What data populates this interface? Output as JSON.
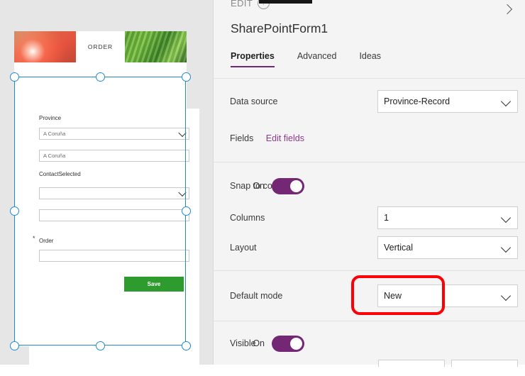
{
  "canvas": {
    "app_header": {
      "title": "ORDER",
      "left_image": "tomato-photo",
      "right_image": "green-leaves-photo"
    },
    "form": {
      "fields": [
        {
          "label": "Province",
          "type": "dropdown",
          "value": "A Coruña",
          "required": false
        },
        {
          "label": "",
          "type": "text",
          "value": "A Coruña",
          "required": false
        },
        {
          "label": "ContactSelected",
          "type": "dropdown",
          "value": "",
          "required": false
        },
        {
          "label": "",
          "type": "text",
          "value": "",
          "required": false
        },
        {
          "label": "Order",
          "type": "text",
          "value": "",
          "required": true
        }
      ],
      "save_label": "Save",
      "save_color": "#2e9b2e"
    },
    "selection_color": "#1f8ad2"
  },
  "panel": {
    "breadcrumb": "EDIT",
    "help_icon": "question-mark-icon",
    "collapse_icon": "chevron-right-icon",
    "title": "SharePointForm1",
    "tabs": [
      {
        "label": "Properties",
        "active": true
      },
      {
        "label": "Advanced",
        "active": false
      },
      {
        "label": "Ideas",
        "active": false
      }
    ],
    "accent_color": "#742774",
    "link_color": "#8a3a8a",
    "highlight_color": "#fb0007",
    "rows": [
      {
        "label": "Data source",
        "control": "dropdown",
        "value": "Province-Record"
      },
      {
        "label": "Fields",
        "control": "link",
        "value": "Edit fields"
      },
      {
        "label": "Snap to columns",
        "control": "toggle",
        "value": "On"
      },
      {
        "label": "Columns",
        "control": "dropdown",
        "value": "1"
      },
      {
        "label": "Layout",
        "control": "dropdown",
        "value": "Vertical"
      },
      {
        "label": "Default mode",
        "control": "dropdown",
        "value": "New"
      },
      {
        "label": "Visible",
        "control": "toggle",
        "value": "On"
      }
    ]
  }
}
